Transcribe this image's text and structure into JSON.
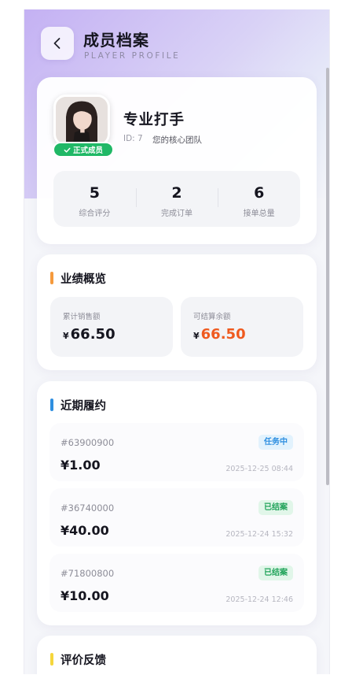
{
  "header": {
    "title": "成员档案",
    "subtitle": "PLAYER PROFILE"
  },
  "profile": {
    "name": "专业打手",
    "id_text": "ID: 7",
    "team": "您的核心团队",
    "badge": "正式成员",
    "stats": [
      {
        "value": "5",
        "label": "综合评分"
      },
      {
        "value": "2",
        "label": "完成订单"
      },
      {
        "value": "6",
        "label": "接单总量"
      }
    ]
  },
  "performance": {
    "title": "业绩概览",
    "total_sales_label": "累计销售额",
    "total_sales_currency": "¥",
    "total_sales": "66.50",
    "balance_label": "可结算余额",
    "balance_currency": "¥",
    "balance": "66.50"
  },
  "orders": {
    "title": "近期履约",
    "items": [
      {
        "id": "#63900900",
        "amount": "¥1.00",
        "status": "任务中",
        "time": "2025-12-25 08:44"
      },
      {
        "id": "#36740000",
        "amount": "¥40.00",
        "status": "已结案",
        "time": "2025-12-24 15:32"
      },
      {
        "id": "#71800800",
        "amount": "¥10.00",
        "status": "已结案",
        "time": "2025-12-24 12:46"
      }
    ]
  },
  "reviews": {
    "title": "评价反馈"
  },
  "colors": {
    "performance_bar": "#f59a3c",
    "orders_bar": "#2f8fe0",
    "reviews_bar": "#f5d63c",
    "badge_green": "#20b866",
    "balance_accent": "#ef5a1f"
  },
  "icons": {
    "back": "chevron-left-icon",
    "badge": "check-icon"
  }
}
